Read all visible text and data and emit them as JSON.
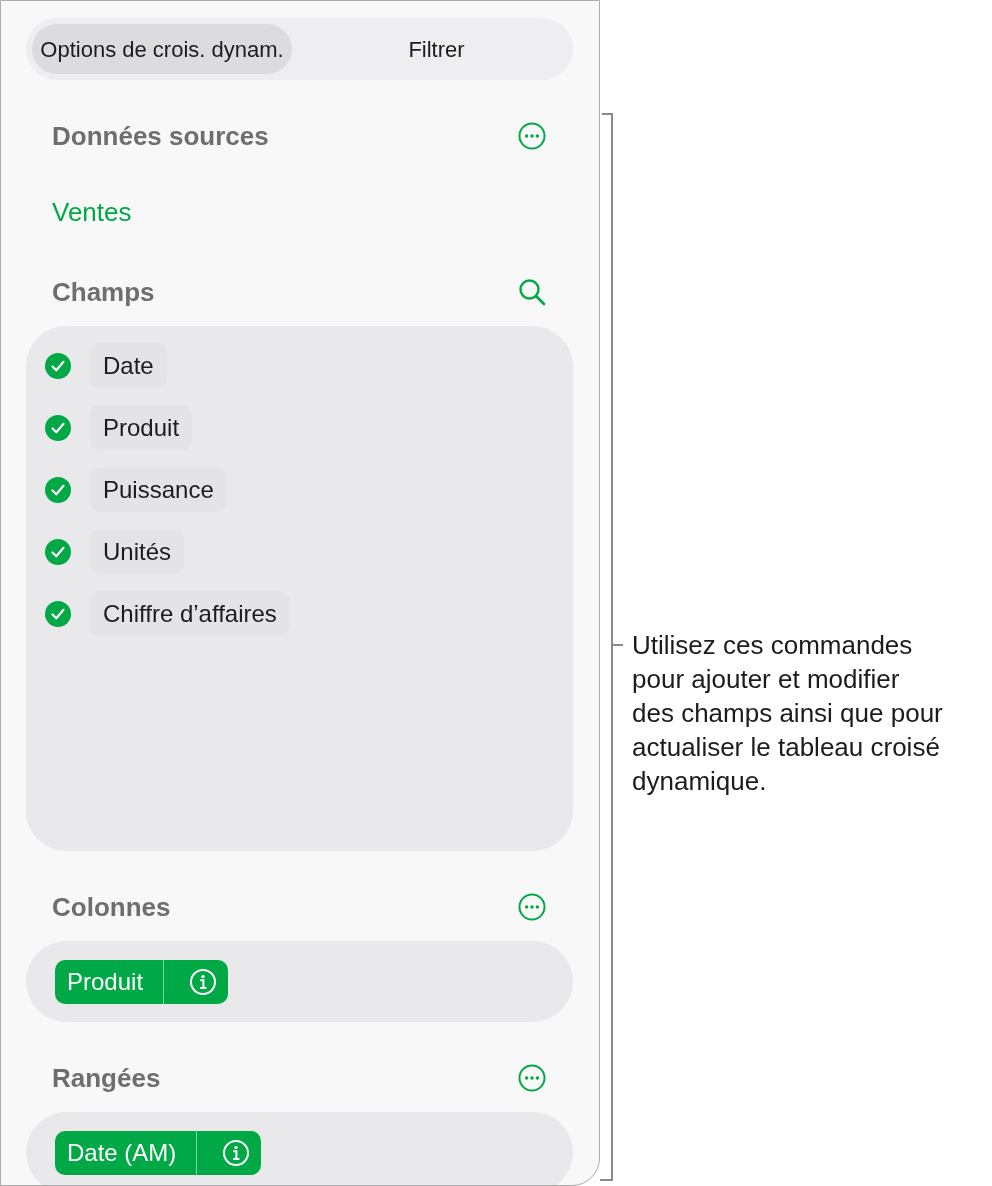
{
  "tabs": [
    {
      "label": "Options de crois. dynam.",
      "selected": true
    },
    {
      "label": "Filtrer",
      "selected": false
    }
  ],
  "sections": [
    {
      "kind": "source",
      "title": "Données sources",
      "value": "Ventes"
    },
    {
      "kind": "fields",
      "title": "Champs",
      "items": [
        {
          "label": "Date",
          "checked": true
        },
        {
          "label": "Produit",
          "checked": true
        },
        {
          "label": "Puissance",
          "checked": true
        },
        {
          "label": "Unités",
          "checked": true
        },
        {
          "label": "Chiffre d’affaires",
          "checked": true
        }
      ]
    },
    {
      "kind": "tags",
      "title": "Colonnes",
      "items": [
        {
          "label": "Produit"
        }
      ]
    },
    {
      "kind": "tags",
      "title": "Rangées",
      "items": [
        {
          "label": "Date (AM)"
        }
      ]
    }
  ],
  "callout": {
    "text": "Utilisez ces commandes pour ajouter et modifier des champs ainsi que pour actualiser le tableau croisé dynamique."
  }
}
